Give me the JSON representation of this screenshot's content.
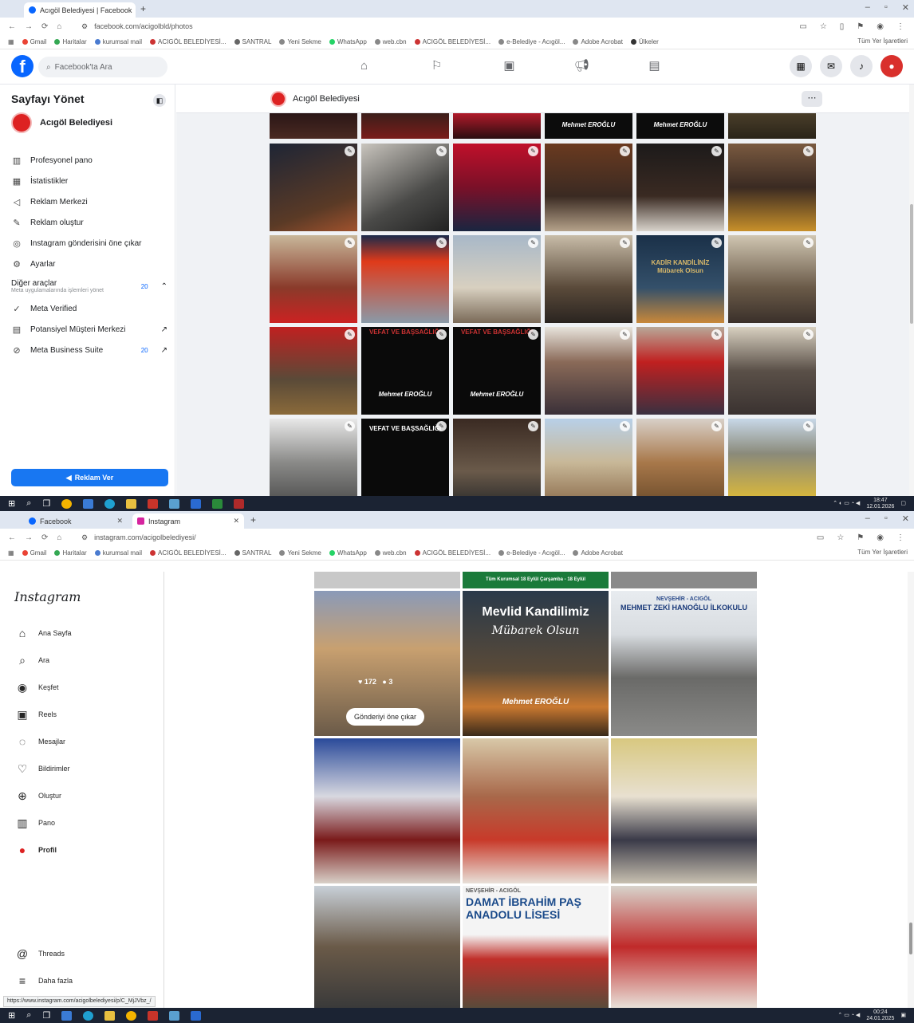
{
  "facebook": {
    "tabs": [
      {
        "title": "Acıgöl Belediyesi | Facebook",
        "active": true
      }
    ],
    "url": "facebook.com/acigolbld/photos",
    "bookmarks": [
      "Gmail",
      "Haritalar",
      "kurumsal mail",
      "ACIGÖL BELEDİYESİ...",
      "SANTRAL",
      "Yeni Sekme",
      "WhatsApp",
      "web.cbn",
      "ACIGÖL BELEDİYESİ...",
      "e-Belediye - Acıgöl...",
      "Adobe Acrobat",
      "Ülkeler"
    ],
    "all_bookmarks": "Tüm Yer İşaretleri",
    "search_placeholder": "Facebook'ta Ara",
    "manage_title": "Sayfayı Yönet",
    "page_name": "Acıgöl Belediyesi",
    "menu": [
      {
        "label": "Profesyonel pano",
        "icon": "dashboard-icon"
      },
      {
        "label": "İstatistikler",
        "icon": "insights-icon"
      },
      {
        "label": "Reklam Merkezi",
        "icon": "megaphone-icon"
      },
      {
        "label": "Reklam oluştur",
        "icon": "edit-icon"
      },
      {
        "label": "Instagram gönderisini öne çıkar",
        "icon": "instagram-icon"
      },
      {
        "label": "Ayarlar",
        "icon": "gear-icon"
      }
    ],
    "other_tools": {
      "title": "Diğer araçlar",
      "subtitle": "Meta uygulamalarında işlemleri yönet",
      "badge": "20"
    },
    "tools": [
      {
        "label": "Meta Verified",
        "icon": "verified-icon"
      },
      {
        "label": "Potansiyel Müşteri Merkezi",
        "icon": "leads-icon"
      },
      {
        "label": "Meta Business Suite",
        "icon": "business-suite-icon",
        "badge": "20"
      }
    ],
    "ad_button": "Reklam Ver",
    "tile_captions": [
      "Mehmet EROĞLU",
      "Mehmet EROĞLU",
      "KADİR KANDİLİNİZ Mübarek Olsun",
      "VEFAT VE BAŞSAĞLIĞI",
      "VEFAT VE BAŞSAĞLIĞI",
      "Mehmet EROĞLU",
      "Mehmet EROĞLU",
      "VEFAT VE BAŞSAĞLIĞI"
    ],
    "clock": {
      "time": "18:47",
      "date": "12.01.2026"
    }
  },
  "instagram": {
    "tabs": [
      {
        "title": "Facebook",
        "active": false
      },
      {
        "title": "Instagram",
        "active": true
      }
    ],
    "url": "instagram.com/acigolbelediyesi/",
    "all_bookmarks": "Tüm Yer İşaretleri",
    "logo": "Instagram",
    "menu": [
      {
        "label": "Ana Sayfa",
        "icon": "home-icon"
      },
      {
        "label": "Ara",
        "icon": "search-icon"
      },
      {
        "label": "Keşfet",
        "icon": "explore-icon"
      },
      {
        "label": "Reels",
        "icon": "reels-icon"
      },
      {
        "label": "Mesajlar",
        "icon": "messages-icon"
      },
      {
        "label": "Bildirimler",
        "icon": "heart-icon"
      },
      {
        "label": "Oluştur",
        "icon": "create-icon"
      },
      {
        "label": "Pano",
        "icon": "dashboard-icon"
      },
      {
        "label": "Profil",
        "icon": "avatar"
      }
    ],
    "threads": "Threads",
    "more": "Daha fazla",
    "post_stats": {
      "likes": "172",
      "comments": "3"
    },
    "boost_button": "Gönderiyi öne çıkar",
    "captions": {
      "mevlid_title": "Mevlid Kandilimiz",
      "mevlid_sub": "Mübarek Olsun",
      "signature": "Mehmet EROĞLU",
      "school1_place": "NEVŞEHİR - ACIGÖL",
      "school1_name": "MEHMET ZEKİ HANOĞLU İLKOKULU",
      "school2_place": "NEVŞEHİR - ACIGÖL",
      "school2_name": "DAMAT İBRAHİM PAŞ ANADOLU LİSESİ",
      "banner": "Tüm Kurumsal   18 Eylül Çarşamba - 18 Eylül"
    },
    "status_url": "https://www.instagram.com/acigolbelediyesi/p/C_MjJVbz_/",
    "clock": {
      "time": "00:24",
      "date": "24.01.2025"
    }
  }
}
